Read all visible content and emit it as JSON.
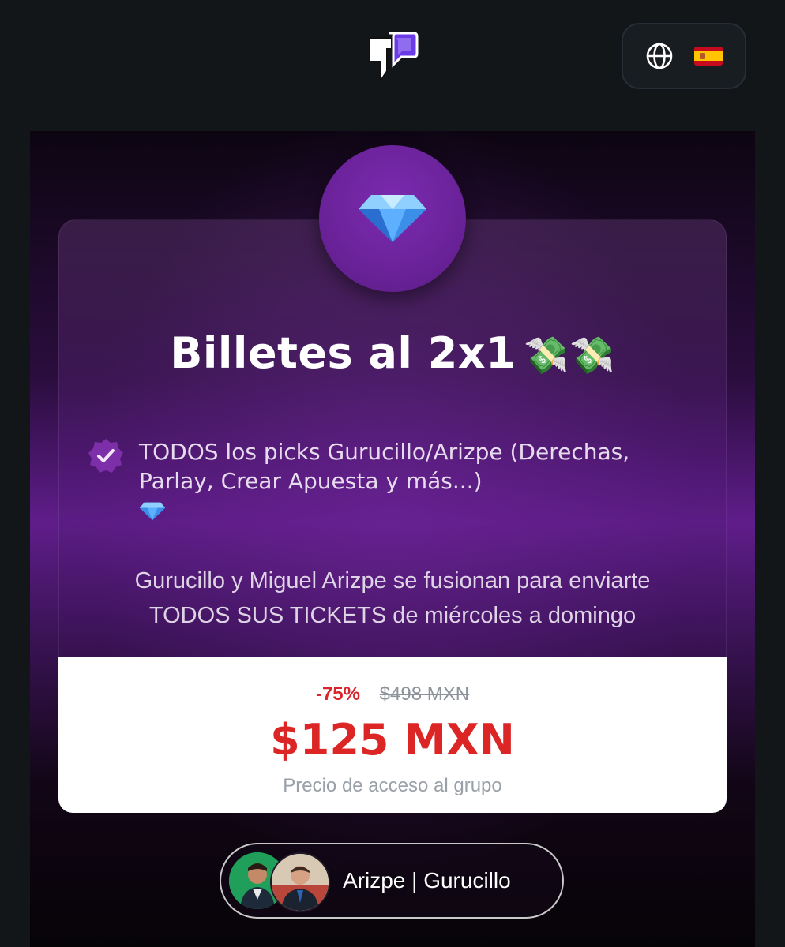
{
  "header": {
    "logo_icon": "brand-logo-icon",
    "language_button": {
      "globe_icon": "globe-icon",
      "flag_icon": "spain-flag-icon"
    }
  },
  "offer": {
    "badge_icon": "gem-icon",
    "title": "Billetes al 2x1",
    "title_emoji": "💸💸",
    "feature": {
      "check_icon": "verified-check-icon",
      "text": "TODOS los picks Gurucillo/Arizpe (Derechas, Parlay, Crear Apuesta y más...)",
      "trailing_icon": "gem-icon"
    },
    "description_line1": "Gurucillo y Miguel Arizpe se fusionan para enviarte",
    "description_line2": "TODOS SUS TICKETS de miércoles a domingo"
  },
  "pricing": {
    "discount": "-75%",
    "original_price": "$498 MXN",
    "price": "$125 MXN",
    "caption": "Precio de acceso al grupo"
  },
  "creator": {
    "name": "Arizpe | Gurucillo"
  },
  "colors": {
    "background": "#121619",
    "purple": "#6a2299",
    "price_red": "#dc2626",
    "white": "#ffffff"
  }
}
